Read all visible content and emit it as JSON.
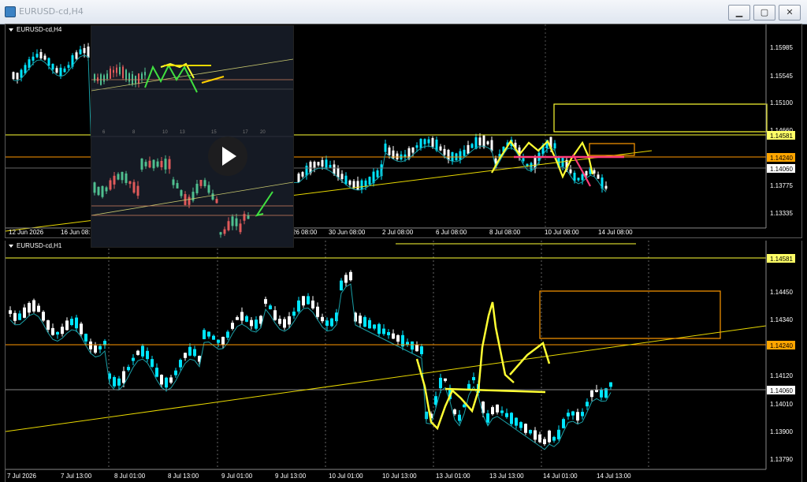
{
  "window": {
    "title": "EURUSD-cd,H4",
    "buttons": {
      "minimize": "▁",
      "maximize": "▢",
      "close": "✕"
    }
  },
  "h4": {
    "title": "EURUSD-cd,H4",
    "price_levels": [
      "1.15985",
      "1.15545",
      "1.15100",
      "1.14660",
      "1.13775",
      "1.13335"
    ],
    "tagged_levels": [
      {
        "label": "1.14581",
        "bg": "#ffff66",
        "fg": "#000000"
      },
      {
        "label": "1.14240",
        "bg": "#ffa500",
        "fg": "#000000"
      },
      {
        "label": "1.14060",
        "bg": "#ffffff",
        "fg": "#000000"
      }
    ],
    "time_labels": [
      "12 Jun 2026",
      "16 Jun 08:",
      "26 08:00",
      "30 Jun 08:00",
      "2 Jul 08:00",
      "6 Jul 08:00",
      "8 Jul 08:00",
      "10 Jul 08:00",
      "14 Jul 08:00"
    ]
  },
  "h1": {
    "title": "EURUSD-cd,H1",
    "price_levels": [
      "1.14450",
      "1.14340",
      "1.14120",
      "1.14010",
      "1.13900",
      "1.13790"
    ],
    "tagged_levels": [
      {
        "label": "1.14581",
        "bg": "#ffff66",
        "fg": "#000000"
      },
      {
        "label": "1.14240",
        "bg": "#ffa500",
        "fg": "#000000"
      },
      {
        "label": "1.14060",
        "bg": "#ffffff",
        "fg": "#000000"
      }
    ],
    "time_labels": [
      "7 Jul 2026",
      "7 Jul 13:00",
      "8 Jul 01:00",
      "8 Jul 13:00",
      "9 Jul 01:00",
      "9 Jul 13:00",
      "10 Jul 01:00",
      "10 Jul 13:00",
      "13 Jul 01:00",
      "13 Jul 13:00",
      "14 Jul 01:00",
      "14 Jul 13:00"
    ]
  },
  "thumbnail": {
    "axis_labels": [
      "6",
      "8",
      "10",
      "13",
      "15",
      "17",
      "20"
    ]
  },
  "colors": {
    "bull": "#00e5ff",
    "bear": "#ffffff",
    "ma": "#1aa0a8",
    "yellow": "#ffff33",
    "orange": "#ff9900",
    "pink": "#ff3c78",
    "green": "#40e040"
  }
}
